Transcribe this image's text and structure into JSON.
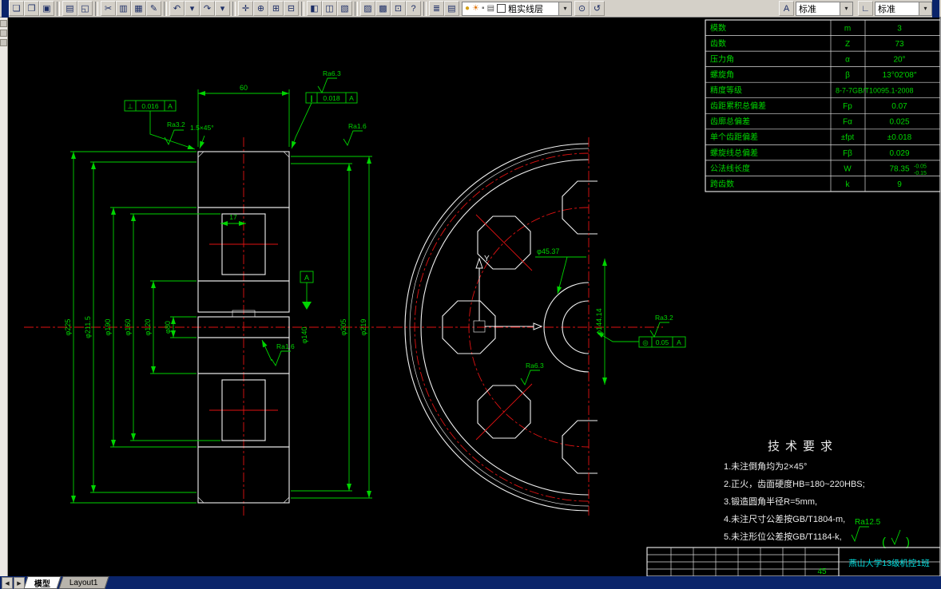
{
  "toolbar": {
    "icons": [
      {
        "name": "new",
        "glyph": "❏"
      },
      {
        "name": "open",
        "glyph": "❐"
      },
      {
        "name": "save",
        "glyph": "▣"
      },
      {
        "sep": true
      },
      {
        "name": "plot",
        "glyph": "▤"
      },
      {
        "name": "plot-preview",
        "glyph": "◱"
      },
      {
        "sep": true
      },
      {
        "name": "cut",
        "glyph": "✂"
      },
      {
        "name": "copy",
        "glyph": "▥"
      },
      {
        "name": "paste",
        "glyph": "▦"
      },
      {
        "name": "match-properties",
        "glyph": "✎"
      },
      {
        "sep": true
      },
      {
        "name": "undo",
        "glyph": "↶"
      },
      {
        "name": "undo-list",
        "glyph": "▾"
      },
      {
        "name": "redo",
        "glyph": "↷"
      },
      {
        "name": "redo-list",
        "glyph": "▾"
      },
      {
        "sep": true
      },
      {
        "name": "pan",
        "glyph": "✛"
      },
      {
        "name": "zoom-realtime",
        "glyph": "⊕"
      },
      {
        "name": "zoom-window",
        "glyph": "⊞"
      },
      {
        "name": "zoom-previous",
        "glyph": "⊟"
      },
      {
        "sep": true
      },
      {
        "name": "properties",
        "glyph": "◧"
      },
      {
        "name": "designcenter",
        "glyph": "◫"
      },
      {
        "name": "tool-palettes",
        "glyph": "▧"
      },
      {
        "sep": true
      },
      {
        "name": "sheet-set-manager",
        "glyph": "▨"
      },
      {
        "name": "markup-set-manager",
        "glyph": "▩"
      },
      {
        "name": "quickcalc",
        "glyph": "⊡"
      },
      {
        "name": "help",
        "glyph": "?"
      },
      {
        "sep": true
      },
      {
        "name": "layer-properties-manager",
        "glyph": "≣"
      },
      {
        "name": "layer-states",
        "glyph": "▤"
      }
    ],
    "post_icons": [
      {
        "name": "make-object-layer-current",
        "glyph": "⊙"
      },
      {
        "name": "layer-previous",
        "glyph": "↺"
      }
    ],
    "layer_control": {
      "bulb_glyph": "●",
      "freeze_glyph": "☀",
      "lock_glyph": "▪",
      "plot_glyph": "▤",
      "selected_layer": "粗实线层",
      "dropdown_arrow": "▾"
    },
    "text_style": {
      "icon_glyph": "A",
      "value": "标准",
      "dropdown_arrow": "▾"
    },
    "dim_style": {
      "icon_glyph": "∟",
      "value": "标准",
      "dropdown_arrow": "▾"
    }
  },
  "drawing": {
    "left_view": {
      "top_dim": "60",
      "inner_dim": "17",
      "chamfer_label": "1.5×45°",
      "left_dims": [
        "φ225",
        "φ211.5",
        "φ190",
        "φ160",
        "φ120",
        "φ80"
      ],
      "right_dims": [
        "φ205",
        "φ219"
      ],
      "hub_dim": "φ140",
      "datum_label": "A",
      "tol_frame_left": {
        "symbol": "⊥",
        "value": "0.016",
        "datum": "A"
      },
      "tol_frame_right": {
        "symbol": "∥",
        "value": "0.018",
        "datum": "A"
      },
      "roughness": {
        "ra63": "Ra6.3",
        "ra32_left": "Ra3.2",
        "ra16_right": "Ra1.6",
        "ra16_bore": "Ra1.6"
      }
    },
    "right_view": {
      "y_axis_label": "Y",
      "hub_dim": "φ45.37",
      "vertical_dim": "φ144.14",
      "tol_frame": {
        "symbol": "◎",
        "value": "0.05",
        "datum": "A"
      },
      "roughness": {
        "ra32": "Ra3.2",
        "ra63": "Ra6.3"
      }
    }
  },
  "parameter_table": {
    "rows": [
      {
        "name": "模数",
        "symbol": "m",
        "value": "3"
      },
      {
        "name": "齿数",
        "symbol": "Z",
        "value": "73"
      },
      {
        "name": "压力角",
        "symbol": "α",
        "value": "20°"
      },
      {
        "name": "螺旋角",
        "symbol": "β",
        "value": "13°02′08″"
      },
      {
        "name": "精度等级",
        "symbol": "",
        "value": "8-7-7GB/T10095.1-2008",
        "wide": true
      },
      {
        "name": "齿距累积总偏差",
        "symbol": "Fp",
        "value": "0.07"
      },
      {
        "name": "齿廓总偏差",
        "symbol": "Fα",
        "value": "0.025"
      },
      {
        "name": "单个齿距偏差",
        "symbol": "±fpt",
        "value": "±0.018"
      },
      {
        "name": "螺旋线总偏差",
        "symbol": "Fβ",
        "value": "0.029"
      },
      {
        "name": "公法线长度",
        "symbol": "W",
        "value": "78.35",
        "tol_upper": "-0.05",
        "tol_lower": "-0.15"
      },
      {
        "name": "跨齿数",
        "symbol": "k",
        "value": "9"
      }
    ]
  },
  "technical_requirements": {
    "title": "技术要求",
    "items": [
      "1.未注倒角均为2×45°",
      "2.正火，齿面硬度HB=180~220HBS;",
      "3.锻造圆角半径R=5mm,",
      "4.未注尺寸公差按GB/T1804-m,",
      "5.未注形位公差按GB/T1184-k,"
    ]
  },
  "surface_note": {
    "ra": "Ra12.5",
    "open_paren": "(",
    "close_paren": ")"
  },
  "title_block": {
    "material": "45",
    "class_name": "燕山大学13级机控1班"
  },
  "status_bar": {
    "scroll_left": "◀",
    "scroll_right": "▶",
    "model_tab": "模型",
    "layout_tab": "Layout1"
  }
}
